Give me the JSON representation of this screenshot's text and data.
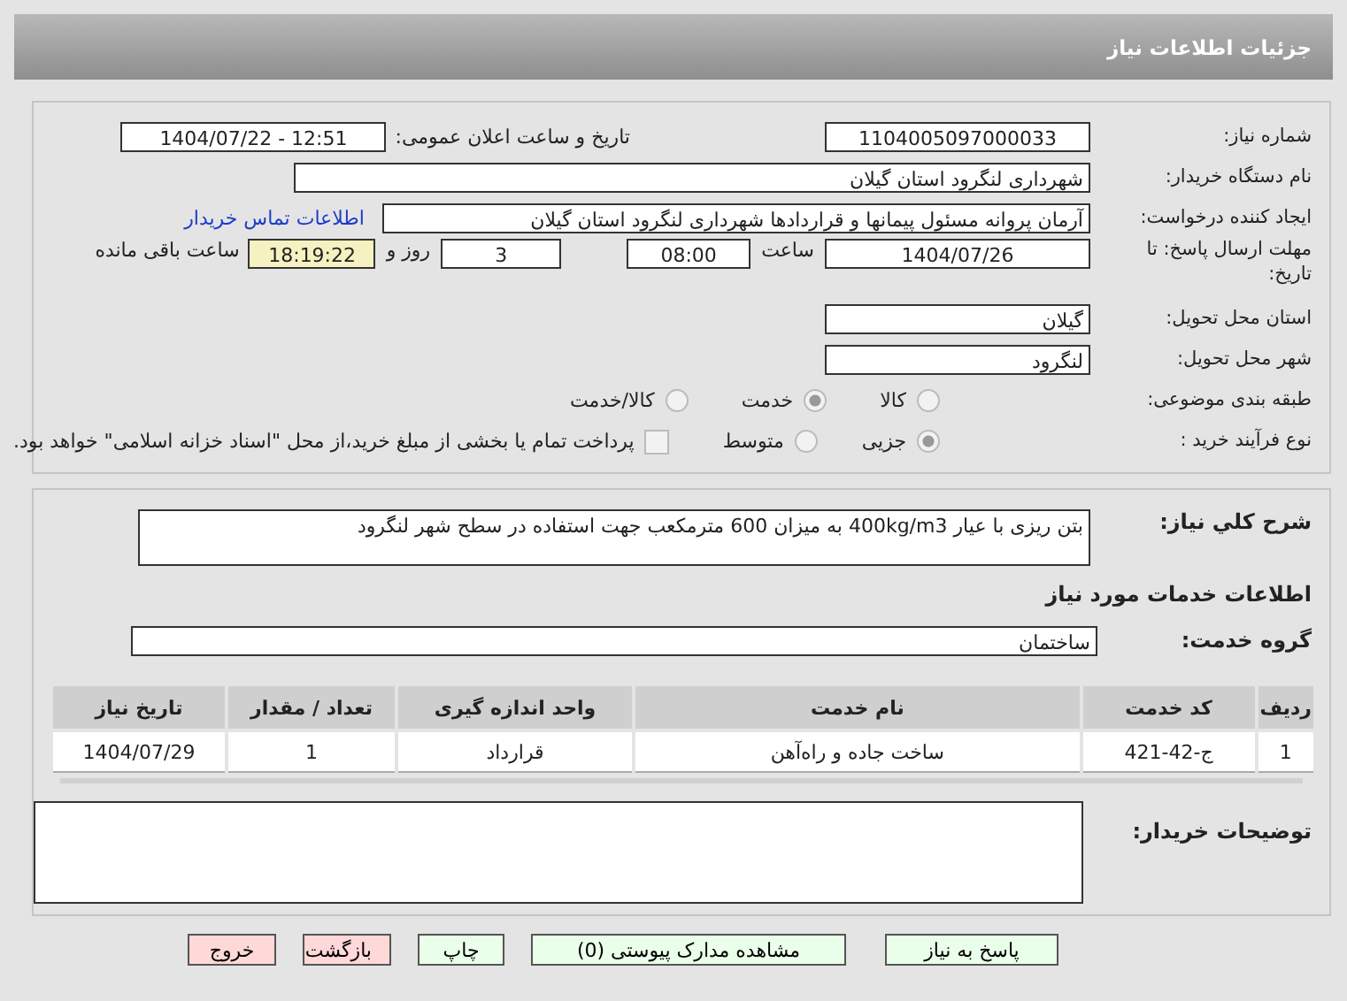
{
  "header": {
    "title": "جزئیات اطلاعات نیاز"
  },
  "need_number": {
    "label": "شماره نیاز:",
    "value": "1104005097000033"
  },
  "announce": {
    "label": "تاریخ و ساعت اعلان عمومی:",
    "value": "1404/07/22 - 12:51"
  },
  "buyer": {
    "label": "نام دستگاه خریدار:",
    "value": "شهرداری لنگرود استان گیلان"
  },
  "creator": {
    "label": "ایجاد کننده درخواست:",
    "value": "آرمان پروانه مسئول پیمانها و قراردادها شهرداری لنگرود استان گیلان",
    "link": "اطلاعات تماس خریدار"
  },
  "deadline": {
    "label": "مهلت ارسال پاسخ: تا تاریخ:",
    "date": "1404/07/26",
    "time_label": "ساعت",
    "time": "08:00",
    "days": "3",
    "days_label": "روز و",
    "remaining": "18:19:22",
    "remaining_label": "ساعت باقی مانده"
  },
  "province": {
    "label": "استان محل تحویل:",
    "value": "گیلان"
  },
  "city": {
    "label": "شهر محل تحویل:",
    "value": "لنگرود"
  },
  "category": {
    "label": "طبقه بندی موضوعی:",
    "options": [
      {
        "label": "کالا",
        "selected": false
      },
      {
        "label": "خدمت",
        "selected": true
      },
      {
        "label": "کالا/خدمت",
        "selected": false
      }
    ]
  },
  "process": {
    "label": "نوع فرآیند خرید :",
    "options": [
      {
        "label": "جزیی",
        "selected": true
      },
      {
        "label": "متوسط",
        "selected": false
      }
    ],
    "payment": {
      "label": "پرداخت تمام یا بخشی از مبلغ خرید،از محل \"اسناد خزانه اسلامی\" خواهد بود.",
      "checked": false
    }
  },
  "summary": {
    "label": "شرح کلي نياز:",
    "value": "بتن ریزی با عیار 400kg/m3 به میزان 600 مترمکعب جهت استفاده در سطح شهر لنگرود"
  },
  "services_heading": "اطلاعات خدمات مورد نیاز",
  "service_group": {
    "label": "گروه خدمت:",
    "value": "ساختمان"
  },
  "table": {
    "columns": [
      "ردیف",
      "کد خدمت",
      "نام خدمت",
      "واحد اندازه گیری",
      "تعداد / مقدار",
      "تاریخ نیاز"
    ],
    "rows": [
      [
        "1",
        "ج-42-421",
        "ساخت جاده و راه‌آهن",
        "قرارداد",
        "1",
        "1404/07/29"
      ]
    ]
  },
  "buyer_notes": {
    "label": "توضیحات خریدار:"
  },
  "buttons": [
    {
      "label": "پاسخ به نیاز",
      "kind": "green"
    },
    {
      "label": "مشاهده مدارک پیوستی (0)",
      "kind": "green"
    },
    {
      "label": "چاپ",
      "kind": "green"
    },
    {
      "label": "بازگشت",
      "kind": "red"
    },
    {
      "label": "خروج",
      "kind": "red"
    }
  ]
}
